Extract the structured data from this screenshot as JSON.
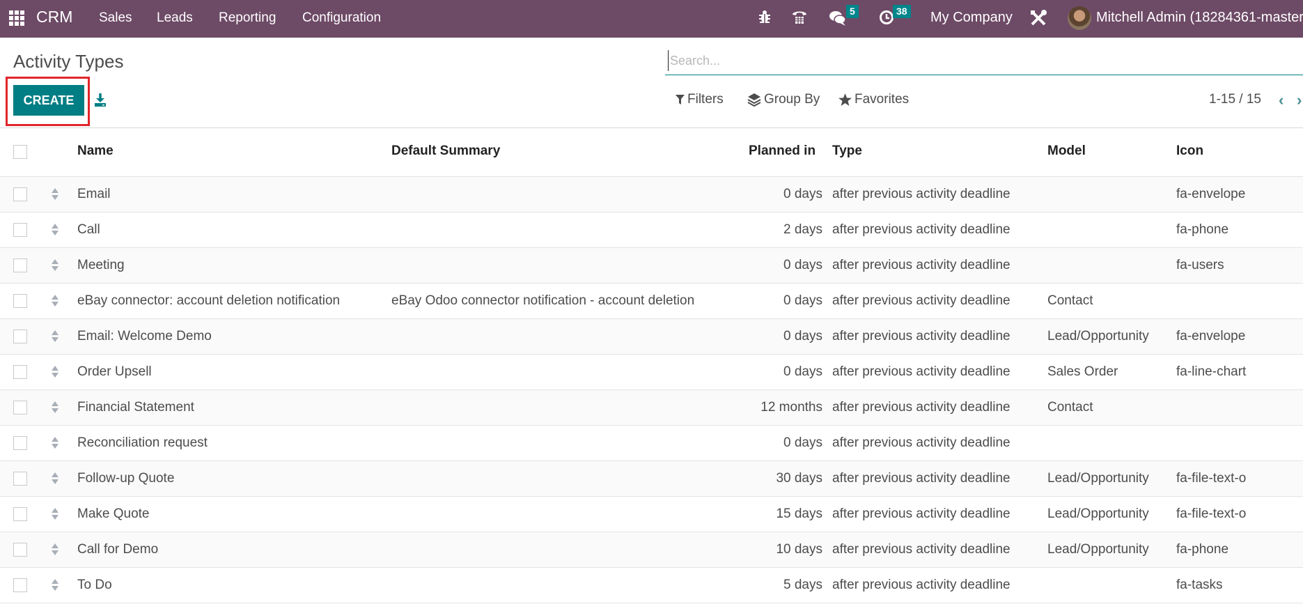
{
  "navbar": {
    "app_name": "CRM",
    "menus": [
      "Sales",
      "Leads",
      "Reporting",
      "Configuration"
    ],
    "icons": [
      "bug-icon",
      "phone-icon",
      "chat-icon",
      "clock-icon"
    ],
    "messages_count": "5",
    "activities_count": "38",
    "company": "My Company",
    "user": "Mitchell Admin (18284361-master-"
  },
  "page": {
    "title": "Activity Types",
    "create_label": "CREATE"
  },
  "search": {
    "placeholder": "Search...",
    "value": "",
    "filters_label": "Filters",
    "group_by_label": "Group By",
    "favorites_label": "Favorites"
  },
  "pager": {
    "value": "1-15 / 15",
    "prev": "‹",
    "next": "›"
  },
  "colors": {
    "navbar": "#6d4a66",
    "primary": "#017e84",
    "badge": "#00868b",
    "highlight": "#e0262b"
  },
  "table": {
    "columns": [
      "Name",
      "Default Summary",
      "Planned in",
      "Type",
      "Model",
      "Icon"
    ],
    "rows": [
      {
        "name": "Email",
        "summary": "",
        "planned": "0 days",
        "type": "after previous activity deadline",
        "model": "",
        "icon": "fa-envelope"
      },
      {
        "name": "Call",
        "summary": "",
        "planned": "2 days",
        "type": "after previous activity deadline",
        "model": "",
        "icon": "fa-phone"
      },
      {
        "name": "Meeting",
        "summary": "",
        "planned": "0 days",
        "type": "after previous activity deadline",
        "model": "",
        "icon": "fa-users"
      },
      {
        "name": "eBay connector: account deletion notification",
        "summary": "eBay Odoo connector notification - account deletion",
        "planned": "0 days",
        "type": "after previous activity deadline",
        "model": "Contact",
        "icon": ""
      },
      {
        "name": "Email: Welcome Demo",
        "summary": "",
        "planned": "0 days",
        "type": "after previous activity deadline",
        "model": "Lead/Opportunity",
        "icon": "fa-envelope"
      },
      {
        "name": "Order Upsell",
        "summary": "",
        "planned": "0 days",
        "type": "after previous activity deadline",
        "model": "Sales Order",
        "icon": "fa-line-chart"
      },
      {
        "name": "Financial Statement",
        "summary": "",
        "planned": "12 months",
        "type": "after previous activity deadline",
        "model": "Contact",
        "icon": ""
      },
      {
        "name": "Reconciliation request",
        "summary": "",
        "planned": "0 days",
        "type": "after previous activity deadline",
        "model": "",
        "icon": ""
      },
      {
        "name": "Follow-up Quote",
        "summary": "",
        "planned": "30 days",
        "type": "after previous activity deadline",
        "model": "Lead/Opportunity",
        "icon": "fa-file-text-o"
      },
      {
        "name": "Make Quote",
        "summary": "",
        "planned": "15 days",
        "type": "after previous activity deadline",
        "model": "Lead/Opportunity",
        "icon": "fa-file-text-o"
      },
      {
        "name": "Call for Demo",
        "summary": "",
        "planned": "10 days",
        "type": "after previous activity deadline",
        "model": "Lead/Opportunity",
        "icon": "fa-phone"
      },
      {
        "name": "To Do",
        "summary": "",
        "planned": "5 days",
        "type": "after previous activity deadline",
        "model": "",
        "icon": "fa-tasks"
      }
    ]
  }
}
